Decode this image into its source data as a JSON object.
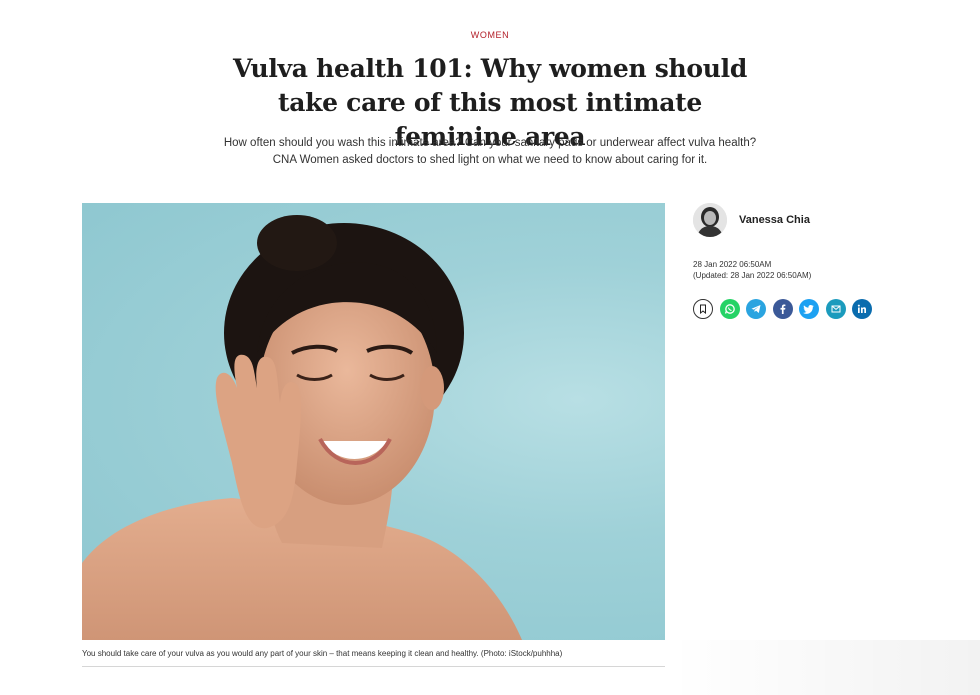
{
  "article": {
    "category": "WOMEN",
    "headline": "Vulva health 101: Why women should take care of this most intimate feminine area",
    "summary": "How often should you wash this intimate area? Can your sanitary pads or underwear affect vulva health? CNA Women asked doctors to shed light on what we need to know about caring for it.",
    "caption": "You should take care of your vulva as you would any part of your skin – that means keeping it clean and healthy. (Photo: iStock/puhhha)"
  },
  "author": {
    "name": "Vanessa Chia",
    "published": "28 Jan 2022 06:50AM",
    "updated": "(Updated: 28 Jan 2022 06:50AM)"
  },
  "share": {
    "icons": [
      "bookmark-icon",
      "whatsapp-icon",
      "telegram-icon",
      "facebook-icon",
      "twitter-icon",
      "email-icon",
      "linkedin-icon"
    ],
    "colors": {
      "whatsapp": "#25d366",
      "telegram": "#2aa4e0",
      "facebook": "#3b5998",
      "twitter": "#1da1f2",
      "email": "#1b9bbd",
      "linkedin": "#0a6cae"
    }
  },
  "colors": {
    "category": "#b3202a",
    "hero_background": "#9fd1d8"
  }
}
